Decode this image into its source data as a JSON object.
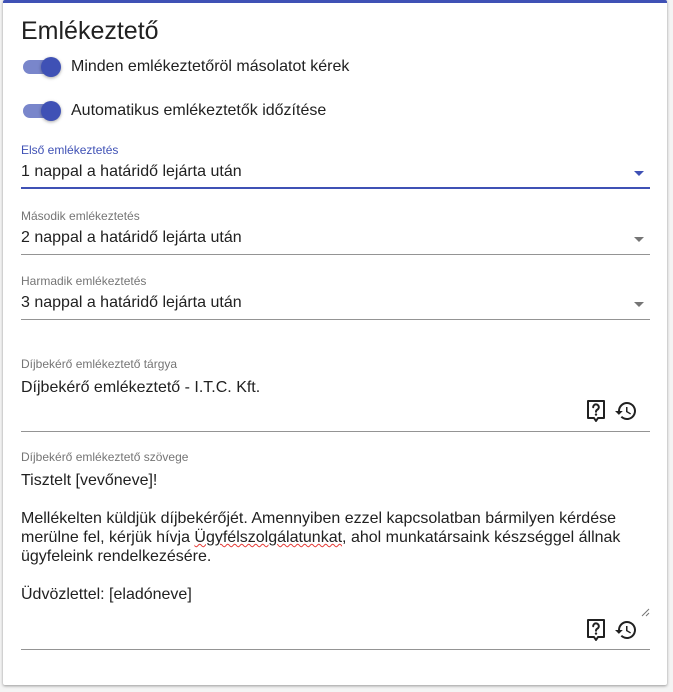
{
  "title": "Emlékeztető",
  "toggles": [
    {
      "label": "Minden emlékeztetőröl másolatot kérek",
      "on": true
    },
    {
      "label": "Automatikus emlékeztetők időzítése",
      "on": true
    }
  ],
  "selects": [
    {
      "label": "Első emlékeztetés",
      "value": "1 nappal a határidő lejárta után"
    },
    {
      "label": "Második emlékeztetés",
      "value": "2 nappal a határidő lejárta után"
    },
    {
      "label": "Harmadik emlékeztetés",
      "value": "3 nappal a határidő lejárta után"
    }
  ],
  "subject": {
    "label": "Díjbekérő emlékeztető tárgya",
    "value": "Díjbekérő emlékeztető - I.T.C. Kft."
  },
  "body": {
    "label": "Díjbekérő emlékeztető szövege",
    "greeting": "Tisztelt [vevőneve]!",
    "paragraph_before": "Mellékelten küldjük díjbekérőjét. Amennyiben ezzel kapcsolatban bármilyen kérdése merülne fel, kérjük hívja ",
    "paragraph_misspelled": "Ügyfélszolgálatunkat",
    "paragraph_after": ", ahol munkatársaink készséggel állnak ügyfeleink rendelkezésére.",
    "closing": "Üdvözlettel: [eladóneve]"
  },
  "icons": {
    "help": "help-placeholder-icon",
    "restore": "restore-icon",
    "accent": "#3f51b5"
  }
}
